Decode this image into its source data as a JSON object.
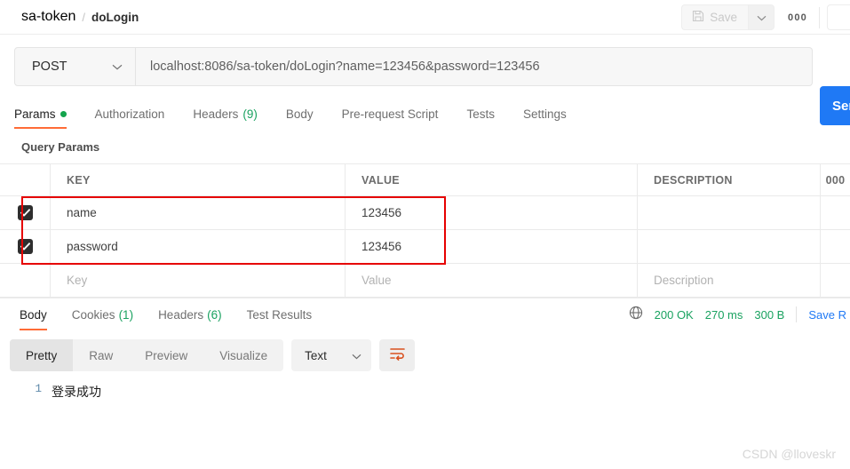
{
  "breadcrumb": {
    "collection": "sa-token",
    "separator": "/",
    "request": "doLogin"
  },
  "topbar": {
    "save_label": "Save",
    "save_icon": "floppy-disk-icon",
    "caret_icon": "chevron-down-icon",
    "more_label": "000",
    "more_icon": "ellipsis-icon"
  },
  "request": {
    "method": "POST",
    "method_caret": "chevron-down-icon",
    "url": "localhost:8086/sa-token/doLogin?name=123456&password=123456",
    "send_label": "Send",
    "send_color": "#1f79f5"
  },
  "request_tabs": [
    {
      "label": "Params",
      "badge": "",
      "dot": true,
      "active": true
    },
    {
      "label": "Authorization",
      "badge": "",
      "dot": false,
      "active": false
    },
    {
      "label": "Headers",
      "badge": "(9)",
      "dot": false,
      "active": false
    },
    {
      "label": "Body",
      "badge": "",
      "dot": false,
      "active": false
    },
    {
      "label": "Pre-request Script",
      "badge": "",
      "dot": false,
      "active": false
    },
    {
      "label": "Tests",
      "badge": "",
      "dot": false,
      "active": false
    },
    {
      "label": "Settings",
      "badge": "",
      "dot": false,
      "active": false
    }
  ],
  "params": {
    "section_title": "Query Params",
    "columns": [
      "KEY",
      "VALUE",
      "DESCRIPTION"
    ],
    "more_label": "000",
    "rows": [
      {
        "checked": true,
        "key": "name",
        "value": "123456",
        "description": ""
      },
      {
        "checked": true,
        "key": "password",
        "value": "123456",
        "description": ""
      }
    ],
    "empty_row": {
      "key_placeholder": "Key",
      "value_placeholder": "Value",
      "description_placeholder": "Description"
    },
    "highlight_color": "#e60000"
  },
  "response_tabs": [
    {
      "label": "Body",
      "badge": "",
      "active": true
    },
    {
      "label": "Cookies",
      "badge": "(1)",
      "active": false
    },
    {
      "label": "Headers",
      "badge": "(6)",
      "active": false
    },
    {
      "label": "Test Results",
      "badge": "",
      "active": false
    }
  ],
  "response_status": {
    "globe_icon": "globe-icon",
    "status": "200 OK",
    "time": "270 ms",
    "size": "300 B",
    "save_response": "Save R",
    "status_color": "#1aa260"
  },
  "response_format": {
    "views": [
      "Pretty",
      "Raw",
      "Preview",
      "Visualize"
    ],
    "active_view": "Pretty",
    "language": "Text",
    "language_caret": "chevron-down-icon",
    "wrap_icon": "word-wrap-icon",
    "wrap_color": "#d9501e"
  },
  "response_body": {
    "lines": [
      {
        "number": "1",
        "text": "登录成功"
      }
    ]
  },
  "watermark": "CSDN @lloveskr",
  "accent": "#ff6c37"
}
